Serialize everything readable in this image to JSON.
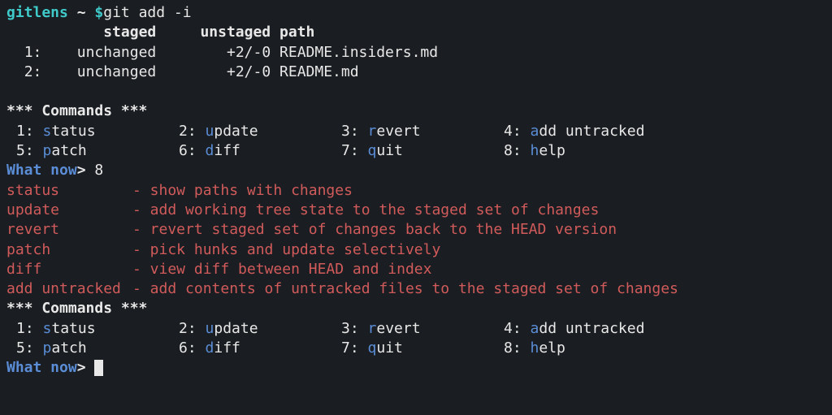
{
  "prompt": {
    "user": "gitlens",
    "tilde": "~",
    "dollar": "$",
    "command": "git add -i"
  },
  "status_header": {
    "col1": "staged",
    "col2": "unstaged",
    "col3": "path"
  },
  "status_rows": [
    {
      "num": "1:",
      "staged": "unchanged",
      "unstaged": "+2/-0",
      "path": "README.insiders.md"
    },
    {
      "num": "2:",
      "staged": "unchanged",
      "unstaged": "+2/-0",
      "path": "README.md"
    }
  ],
  "commands_header": "*** Commands ***",
  "commands": [
    {
      "num": "1:",
      "hl": "s",
      "rest": "tatus"
    },
    {
      "num": "2:",
      "hl": "u",
      "rest": "pdate"
    },
    {
      "num": "3:",
      "hl": "r",
      "rest": "evert"
    },
    {
      "num": "4:",
      "hl": "a",
      "rest": "dd untracked"
    },
    {
      "num": "5:",
      "hl": "p",
      "rest": "atch"
    },
    {
      "num": "6:",
      "hl": "d",
      "rest": "iff"
    },
    {
      "num": "7:",
      "hl": "q",
      "rest": "uit"
    },
    {
      "num": "8:",
      "hl": "h",
      "rest": "elp"
    }
  ],
  "what_now": "What now",
  "input1": "8",
  "help": [
    {
      "cmd": "status",
      "desc": "- show paths with changes"
    },
    {
      "cmd": "update",
      "desc": "- add working tree state to the staged set of changes"
    },
    {
      "cmd": "revert",
      "desc": "- revert staged set of changes back to the HEAD version"
    },
    {
      "cmd": "patch",
      "desc": "- pick hunks and update selectively"
    },
    {
      "cmd": "diff",
      "desc": "- view diff between HEAD and index"
    },
    {
      "cmd": "add untracked",
      "desc": "- add contents of untracked files to the staged set of changes"
    }
  ],
  "gt": ">"
}
